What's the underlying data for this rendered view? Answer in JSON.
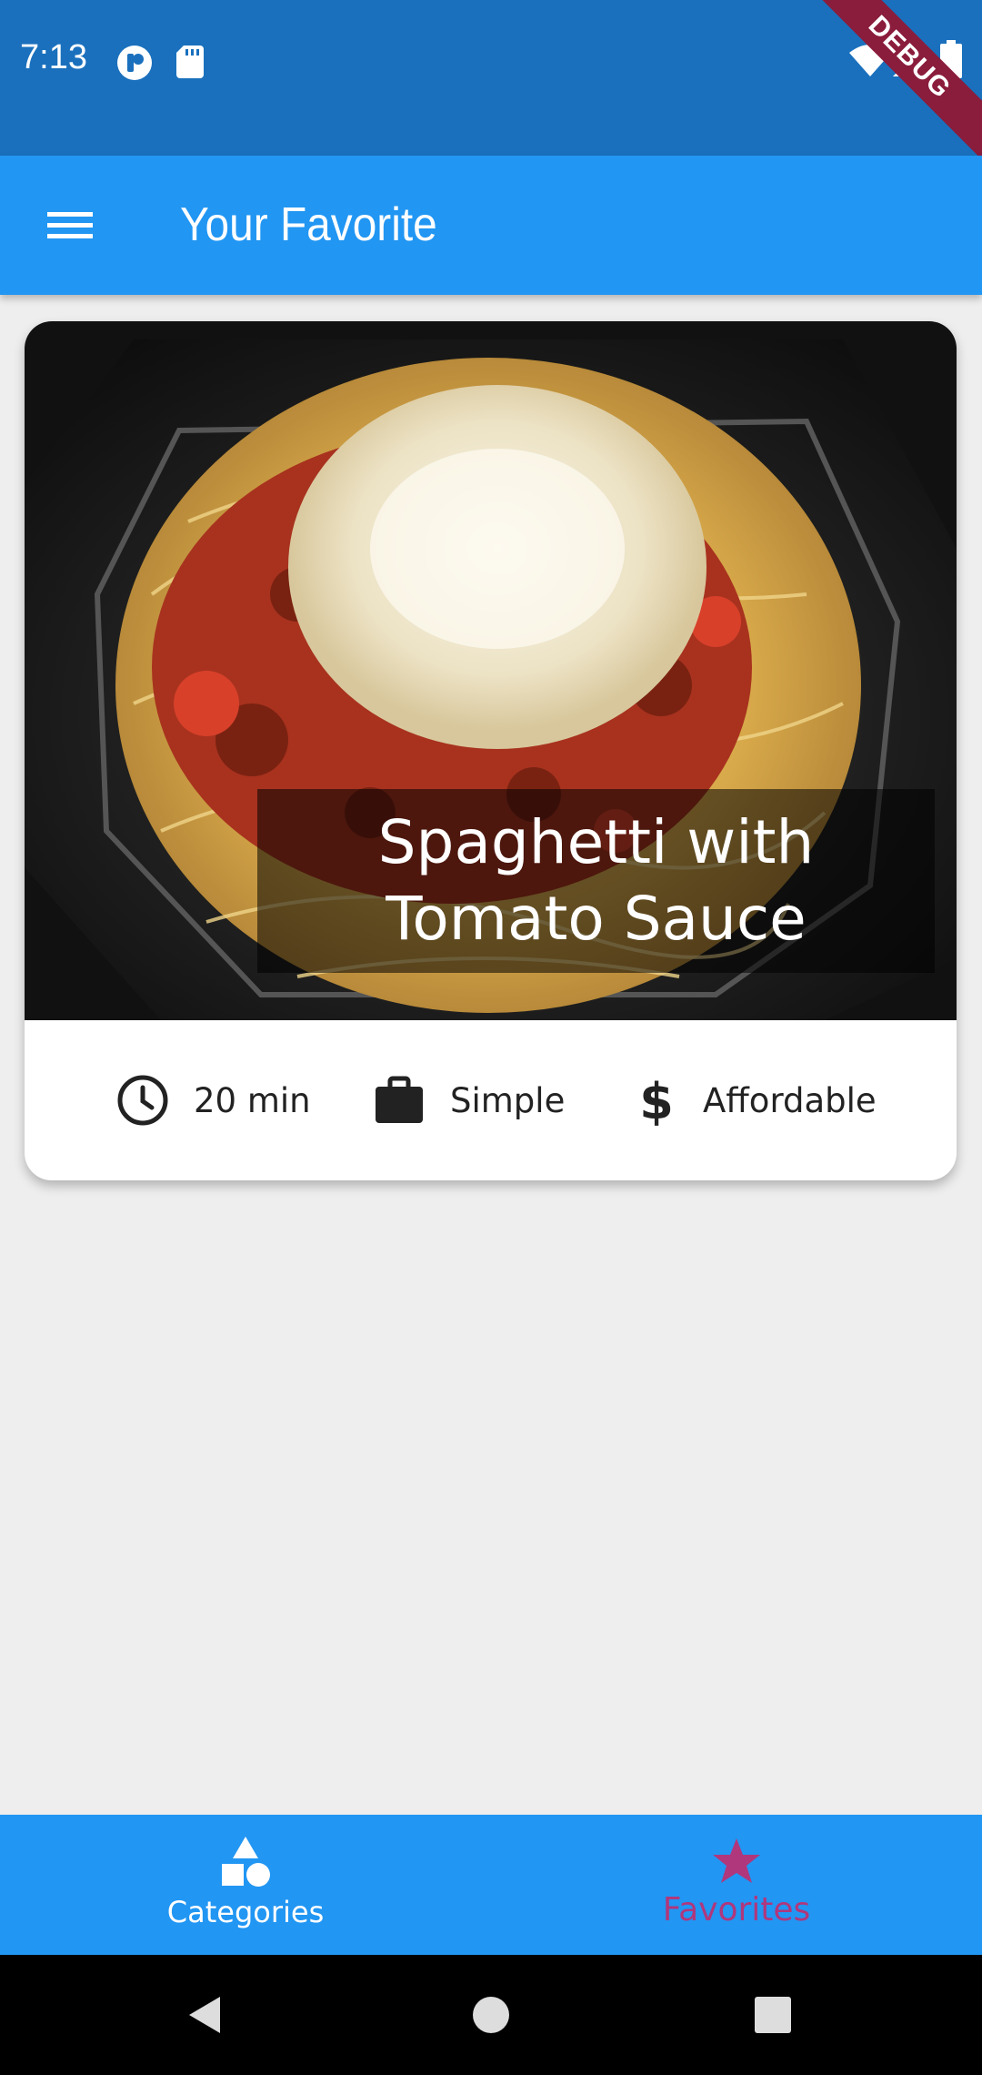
{
  "status_bar": {
    "time": "7:13",
    "debug_label": "DEBUG",
    "icons": [
      "notification-p-icon",
      "sd-card-icon",
      "wifi-icon",
      "signal-icon",
      "battery-icon"
    ]
  },
  "app_bar": {
    "title": "Your Favorite",
    "menu_icon": "hamburger-menu-icon"
  },
  "meal": {
    "title": "Spaghetti with Tomato Sauce",
    "image_description_icon": "spaghetti-photo",
    "duration": "20 min",
    "complexity": "Simple",
    "affordability": "Affordable"
  },
  "bottom_nav": {
    "items": [
      {
        "label": "Categories",
        "icon": "category-icon",
        "active": false
      },
      {
        "label": "Favorites",
        "icon": "star-icon",
        "active": true
      }
    ],
    "active_color": "#b0377c",
    "inactive_color": "#ffffff"
  },
  "colors": {
    "primary": "#2196f3",
    "status_bar": "#1a70bd",
    "accent": "#b0377c",
    "background": "#eeeeee"
  }
}
